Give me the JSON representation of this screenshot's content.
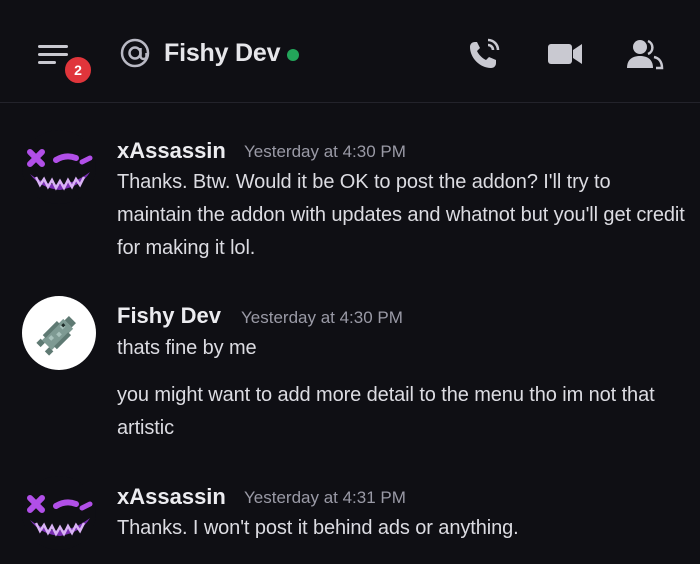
{
  "header": {
    "menu_badge": "2",
    "channel_name": "Fishy Dev",
    "status_color": "#23a55a",
    "icons": [
      "hamburger-menu-icon",
      "at-icon",
      "call-icon",
      "video-icon",
      "members-icon"
    ]
  },
  "messages": [
    {
      "author": "xAssassin",
      "timestamp": "Yesterday at 4:30 PM",
      "lines": [
        "Thanks. Btw. Would it be OK to post the addon? I'll try to maintain the addon with updates and whatnot but you'll get credit for making it lol."
      ]
    },
    {
      "author": "Fishy Dev",
      "timestamp": "Yesterday at 4:30 PM",
      "lines": [
        "thats fine by me",
        "you might want to add more detail to the menu tho im not that artistic"
      ]
    },
    {
      "author": "xAssassin",
      "timestamp": "Yesterday at 4:31 PM",
      "lines": [
        "Thanks. I won't post it behind ads or anything."
      ]
    }
  ],
  "colors": {
    "background": "#0f0f14",
    "badge": "#e0353b",
    "online": "#23a55a"
  }
}
